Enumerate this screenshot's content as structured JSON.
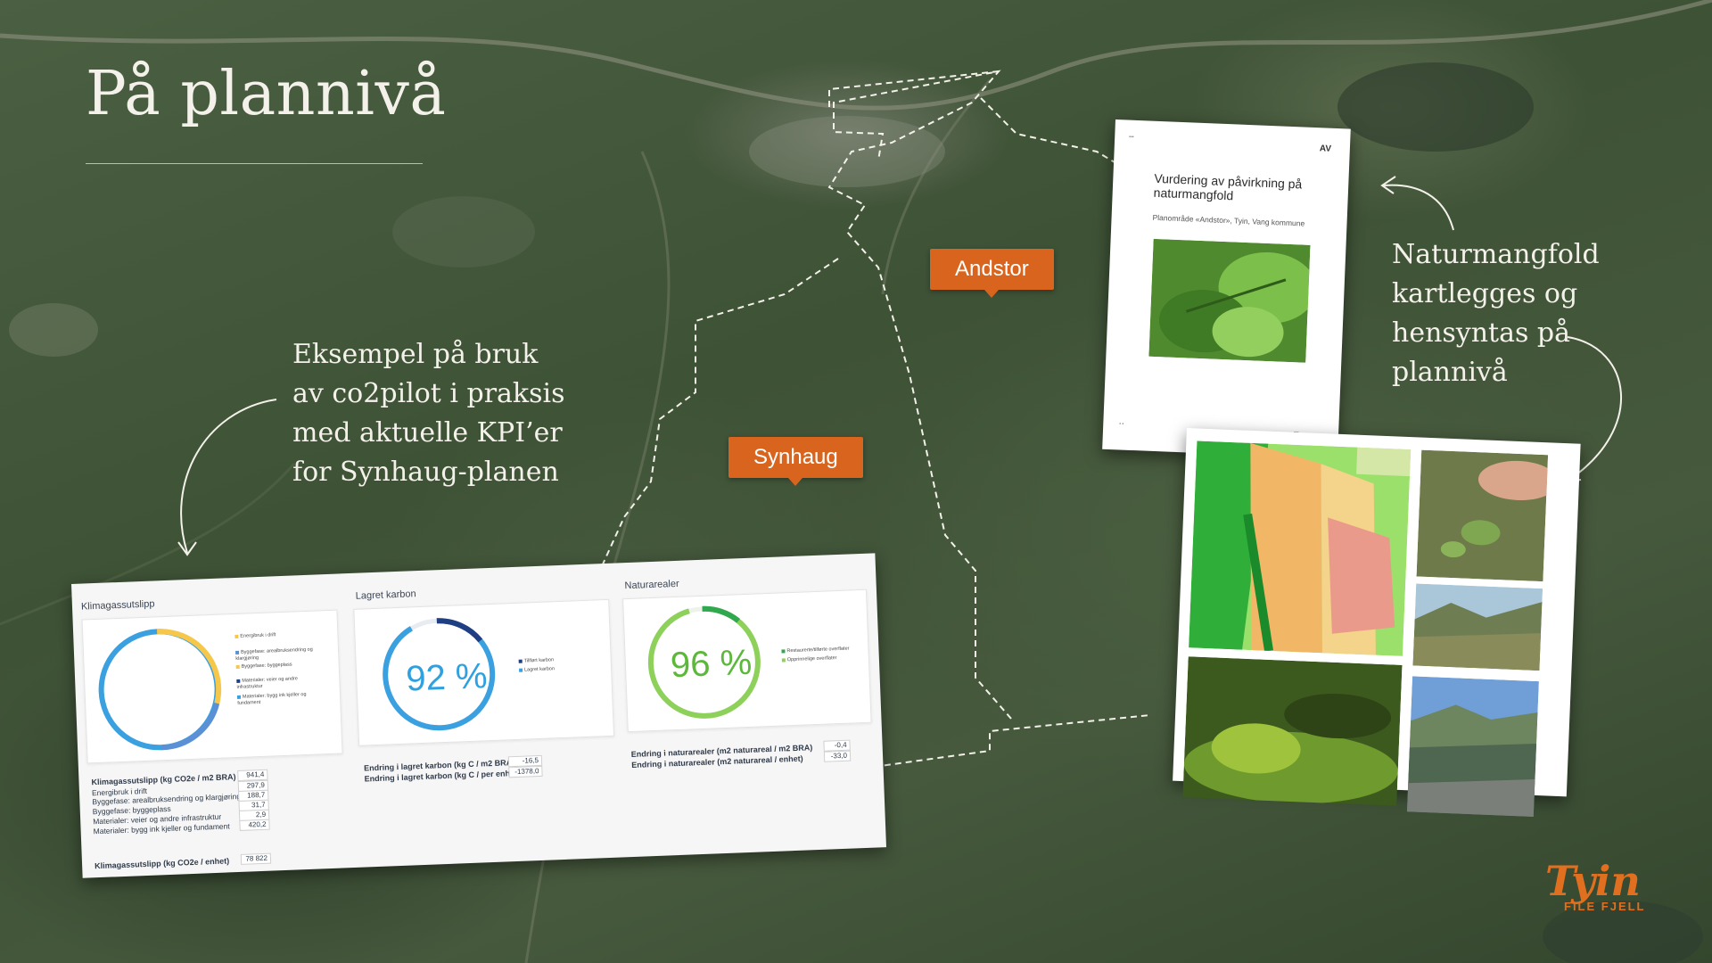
{
  "slide": {
    "title": "På plannivå",
    "caption_left": "Eksempel på bruk\nav co2pilot i praksis\nmed aktuelle KPI’er\nfor Synhaug-planen",
    "caption_right": "Naturmangfold\nkartlegges og\nhensyntas på\nplannivå"
  },
  "pins": {
    "andstor": "Andstor",
    "synhaug": "Synhaug"
  },
  "dashboard": {
    "emissions": {
      "title": "Klimagassutslipp",
      "legend": [
        {
          "label": "Energibruk i drift",
          "color": "#f5c84c"
        },
        {
          "label": "Byggefase: arealbruksendring og klargjøring",
          "color": "#5b8fd6"
        },
        {
          "label": "Byggefase: byggeplass",
          "color": "#f5c84c"
        },
        {
          "label": "Materialer: veier og andre infrastruktur",
          "color": "#1f3f82"
        },
        {
          "label": "Materialer: bygg ink kjeller og fundament",
          "color": "#3aa0e0"
        }
      ],
      "rows": [
        {
          "label": "Klimagassutslipp (kg CO2e / m2 BRA)",
          "value": "941,4"
        },
        {
          "label": "Energibruk i drift",
          "value": "297,9"
        },
        {
          "label": "Byggefase: arealbruksendring og klargjøring",
          "value": "188,7"
        },
        {
          "label": "Byggefase: byggeplass",
          "value": "31,7"
        },
        {
          "label": "Materialer: veier og andre infrastruktur",
          "value": "2,9"
        },
        {
          "label": "Materialer: bygg ink kjeller og fundament",
          "value": "420,2"
        }
      ],
      "per_unit_label": "Klimagassutslipp (kg CO2e / enhet)",
      "per_unit_value": "78 822"
    },
    "carbon": {
      "title": "Lagret karbon",
      "percent": "92 %",
      "fraction": 0.92,
      "legend": [
        {
          "label": "Tillført karbon",
          "color": "#1f3f82"
        },
        {
          "label": "Lagret karbon",
          "color": "#3aa0e0"
        }
      ],
      "rows": [
        {
          "label": "Endring i lagret karbon (kg C / m2 BRA)",
          "value": "-16,5"
        },
        {
          "label": "Endring i lagret karbon (kg C / per enhet)",
          "value": "-1378,0"
        }
      ]
    },
    "nature": {
      "title": "Naturarealer",
      "percent": "96 %",
      "fraction": 0.96,
      "legend": [
        {
          "label": "Restaurerte/tilførte overflater",
          "color": "#2fa84f"
        },
        {
          "label": "Opprinnelige overflater",
          "color": "#8dd05a"
        }
      ],
      "rows": [
        {
          "label": "Endring i naturarealer (m2 naturareal / m2 BRA)",
          "value": "-0,4"
        },
        {
          "label": "Endring i naturarealer (m2 naturareal / enhet)",
          "value": "-33,0"
        }
      ]
    }
  },
  "report": {
    "title": "Vurdering av påvirkning på naturmangfold",
    "subtitle": "Planområde «Andstor», Tyin, Vang kommune",
    "logo": "AV"
  },
  "logo": {
    "wordmark": "Tyin",
    "sub": "FILE FJELL"
  },
  "colors": {
    "pin": "#d9641d",
    "carbon_ring": "#3aa0e0",
    "carbon_dark": "#1f3f82",
    "nature_ring": "#8dd05a",
    "nature_dark": "#2fa84f",
    "logo": "#e0701f"
  }
}
